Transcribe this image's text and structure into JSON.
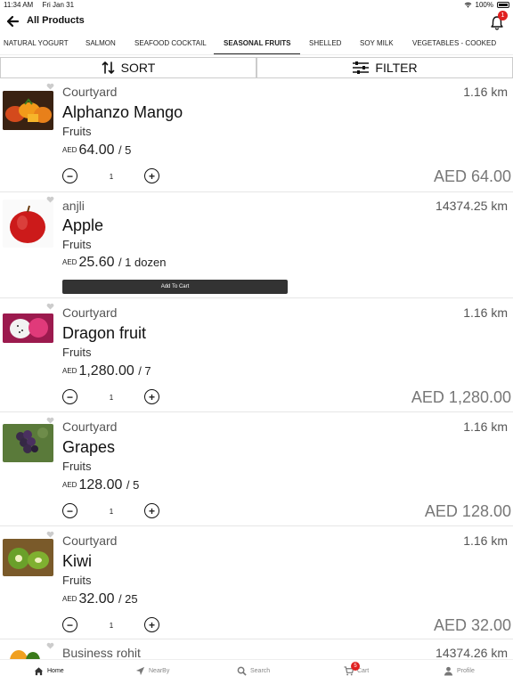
{
  "status": {
    "time": "11:34 AM",
    "date": "Fri Jan 31",
    "battery": "100%"
  },
  "header": {
    "title": "All Products",
    "notification_count": "1"
  },
  "tabs": [
    {
      "label": "NATURAL YOGURT"
    },
    {
      "label": "SALMON"
    },
    {
      "label": "SEAFOOD COCKTAIL"
    },
    {
      "label": "SEASONAL FRUITS",
      "active": true
    },
    {
      "label": "SHELLED"
    },
    {
      "label": "SOY MILK"
    },
    {
      "label": "VEGETABLES - COOKED"
    }
  ],
  "toolbar": {
    "sort_label": "SORT",
    "filter_label": "FILTER"
  },
  "products": [
    {
      "vendor": "Courtyard",
      "distance": "1.16 km",
      "name": "Alphanzo Mango",
      "category": "Fruits",
      "currency": "AED",
      "price": "64.00",
      "unit": "/ 5",
      "qty": "1",
      "total": "AED 64.00",
      "image": "mango-image"
    },
    {
      "vendor": "anjli",
      "distance": "14374.25 km",
      "name": "Apple",
      "category": "Fruits",
      "currency": "AED",
      "price": "25.60",
      "unit": "/ 1 dozen",
      "add_to_cart": "Add To Cart",
      "image": "apple-image"
    },
    {
      "vendor": "Courtyard",
      "distance": "1.16 km",
      "name": "Dragon fruit",
      "category": "Fruits",
      "currency": "AED",
      "price": "1,280.00",
      "unit": "/ 7",
      "qty": "1",
      "total": "AED 1,280.00",
      "image": "dragon-fruit-image"
    },
    {
      "vendor": "Courtyard",
      "distance": "1.16 km",
      "name": "Grapes",
      "category": "Fruits",
      "currency": "AED",
      "price": "128.00",
      "unit": "/ 5",
      "qty": "1",
      "total": "AED 128.00",
      "image": "grapes-image"
    },
    {
      "vendor": "Courtyard",
      "distance": "1.16 km",
      "name": "Kiwi",
      "category": "Fruits",
      "currency": "AED",
      "price": "32.00",
      "unit": "/ 25",
      "qty": "1",
      "total": "AED 32.00",
      "image": "kiwi-image"
    },
    {
      "vendor": "Business rohit",
      "distance": "14374.26 km",
      "image": "papaya-image"
    }
  ],
  "bottom_nav": {
    "home": "Home",
    "nearby": "NearBy",
    "search": "Search",
    "cart": "Cart",
    "cart_count": "5",
    "profile": "Profile"
  }
}
